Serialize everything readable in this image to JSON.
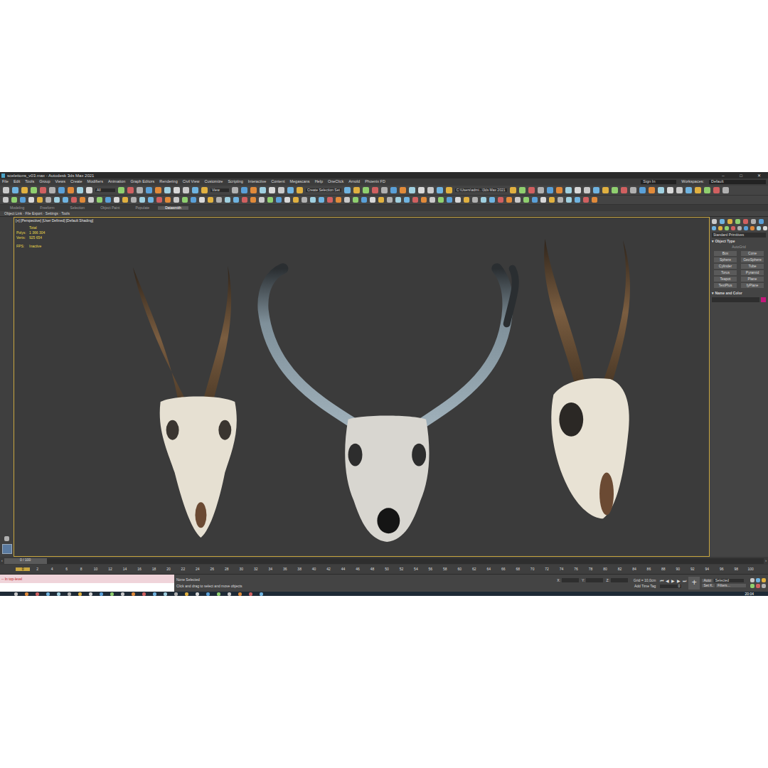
{
  "window": {
    "title": "scelettons_v03.max - Autodesk 3ds Max 2021",
    "controls": [
      "–",
      "□",
      "✕"
    ]
  },
  "menu": [
    "File",
    "Edit",
    "Tools",
    "Group",
    "Views",
    "Create",
    "Modifiers",
    "Animation",
    "Graph Editors",
    "Rendering",
    "Civil View",
    "Customize",
    "Scripting",
    "Interactive",
    "Content",
    "Megascans",
    "Help",
    "OneClick",
    "Arnold",
    "Phoenix FD"
  ],
  "account": {
    "sign_in": "Sign In",
    "workspaces_label": "Workspaces:",
    "workspace": "Default"
  },
  "toolbar": {
    "filter": "All",
    "view": "View",
    "selection_set": "Create Selection Set",
    "path": "C:\\Users\\admi...\\3ds Max 2021"
  },
  "ribbon_tabs": [
    {
      "label": "Modeling",
      "selected": false
    },
    {
      "label": "Freeform",
      "selected": false
    },
    {
      "label": "Selection",
      "selected": false
    },
    {
      "label": "Object Paint",
      "selected": false
    },
    {
      "label": "Populate",
      "selected": false
    },
    {
      "label": "Datasmith",
      "selected": true
    }
  ],
  "ribbon_row": "Object Link · File Export · Settings · Tools",
  "viewport": {
    "label": "[+] [Perspective] [User Defined] [Default Shading]",
    "stats": [
      {
        "key": "",
        "value": "Total"
      },
      {
        "key": "Polys:",
        "value": "1 366 304"
      },
      {
        "key": "Verts:",
        "value": "925 654"
      }
    ],
    "fps_label": "FPS:",
    "fps": "Inactive",
    "active": true
  },
  "command_panel": {
    "category": "Standard Primitives",
    "object_type": "Object Type",
    "autogrid": "AutoGrid",
    "buttons": [
      "Box",
      "Cone",
      "Sphere",
      "GeoSphere",
      "Cylinder",
      "Tube",
      "Torus",
      "Pyramid",
      "Teapot",
      "Plane",
      "TextPlus",
      "fyPlane"
    ],
    "name_and_color": "Name and Color",
    "color": "#c2187a"
  },
  "timeline": {
    "frame": "0 / 100",
    "level": 0,
    "ticks": [
      "0",
      "2",
      "4",
      "6",
      "8",
      "10",
      "12",
      "14",
      "16",
      "18",
      "20",
      "22",
      "24",
      "26",
      "28",
      "30",
      "32",
      "34",
      "36",
      "38",
      "40",
      "42",
      "44",
      "46",
      "48",
      "50",
      "52",
      "54",
      "56",
      "58",
      "60",
      "62",
      "64",
      "66",
      "68",
      "70",
      "72",
      "74",
      "76",
      "78",
      "80",
      "82",
      "84",
      "86",
      "88",
      "90",
      "92",
      "94",
      "96",
      "98",
      "100"
    ]
  },
  "status": {
    "listener": "-- In top-level",
    "selection": "None Selected",
    "prompt": "Click and drag to select and move objects",
    "coords": [
      "X:",
      "Y:",
      "Z:"
    ],
    "grid": "Grid = 10,0cm",
    "time_tag": "Add Time Tag",
    "playback": [
      "⏮",
      "◀",
      "▶",
      "▶",
      "⏭"
    ],
    "frame_field": "0",
    "auto": "Auto",
    "key_mode": "Selected",
    "set_key": "Set K.",
    "filters": "Filters..."
  },
  "taskbar": {
    "time": "20:04"
  }
}
